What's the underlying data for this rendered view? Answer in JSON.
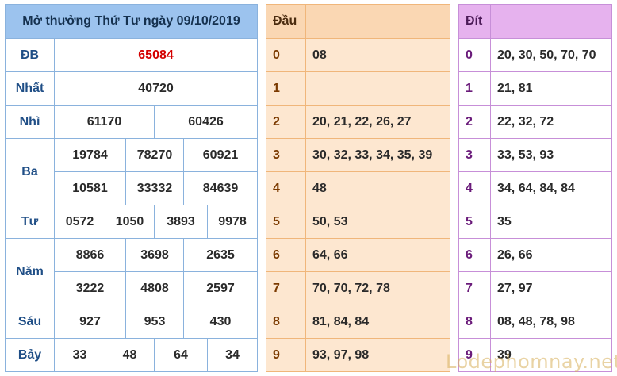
{
  "results": {
    "title": "Mở thưởng Thứ Tư ngày 09/10/2019",
    "rows": {
      "db": {
        "label": "ĐB",
        "values": [
          "65084"
        ]
      },
      "nhat": {
        "label": "Nhất",
        "values": [
          "40720"
        ]
      },
      "nhi": {
        "label": "Nhì",
        "values": [
          "61170",
          "60426"
        ]
      },
      "ba": {
        "label": "Ba",
        "values": [
          "19784",
          "78270",
          "60921",
          "10581",
          "33332",
          "84639"
        ]
      },
      "tu": {
        "label": "Tư",
        "values": [
          "0572",
          "1050",
          "3893",
          "9978"
        ]
      },
      "nam": {
        "label": "Năm",
        "values": [
          "8866",
          "3698",
          "2635",
          "3222",
          "4808",
          "2597"
        ]
      },
      "sau": {
        "label": "Sáu",
        "values": [
          "927",
          "953",
          "430"
        ]
      },
      "bay": {
        "label": "Bảy",
        "values": [
          "33",
          "48",
          "64",
          "34"
        ]
      }
    }
  },
  "dau": {
    "header": "Đầu",
    "rows": [
      {
        "digit": "0",
        "numbers": "08"
      },
      {
        "digit": "1",
        "numbers": ""
      },
      {
        "digit": "2",
        "numbers": "20, 21, 22, 26, 27"
      },
      {
        "digit": "3",
        "numbers": "30, 32, 33, 34, 35, 39"
      },
      {
        "digit": "4",
        "numbers": "48"
      },
      {
        "digit": "5",
        "numbers": "50, 53"
      },
      {
        "digit": "6",
        "numbers": "64, 66"
      },
      {
        "digit": "7",
        "numbers": "70, 70, 72, 78"
      },
      {
        "digit": "8",
        "numbers": "81, 84, 84"
      },
      {
        "digit": "9",
        "numbers": "93, 97, 98"
      }
    ]
  },
  "dit": {
    "header": "Đít",
    "rows": [
      {
        "digit": "0",
        "numbers": "20, 30, 50, 70, 70"
      },
      {
        "digit": "1",
        "numbers": "21, 81"
      },
      {
        "digit": "2",
        "numbers": "22, 32, 72"
      },
      {
        "digit": "3",
        "numbers": "33, 53, 93"
      },
      {
        "digit": "4",
        "numbers": "34, 64, 84, 84"
      },
      {
        "digit": "5",
        "numbers": "35"
      },
      {
        "digit": "6",
        "numbers": "26, 66"
      },
      {
        "digit": "7",
        "numbers": "27, 97"
      },
      {
        "digit": "8",
        "numbers": "08, 48, 78, 98"
      },
      {
        "digit": "9",
        "numbers": "39"
      }
    ]
  },
  "watermark": "Lodephomnay.net",
  "colors": {
    "results_header": "#9cc3ee",
    "special_prize": "#d40000",
    "dau_header": "#fad7b3",
    "dau_body": "#fde7d0",
    "dit_header": "#e6b2ee"
  }
}
